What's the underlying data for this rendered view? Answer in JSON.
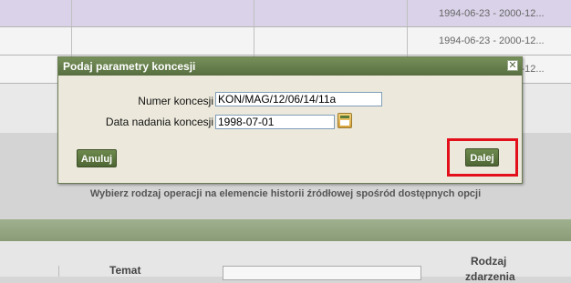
{
  "background_table": {
    "rows": [
      {
        "period": "1994-06-23 - 2000-12..."
      },
      {
        "period": "1994-06-23 - 2000-12..."
      },
      {
        "period": "1994-06-23 - 2000-12..."
      }
    ]
  },
  "instruction": "Wybierz rodzaj operacji na elemencie historii źródłowej spośród dostępnych opcji",
  "bottom_table": {
    "col_temat": "Temat",
    "col_rodzaj": "Rodzaj",
    "col_rodzaj_cont": "zdarzenia"
  },
  "dialog": {
    "title": "Podaj parametry koncesji",
    "close_glyph": "✕",
    "fields": {
      "numer_label": "Numer koncesji",
      "numer_value": "KON/MAG/12/06/14/11a",
      "data_label": "Data nadania koncesji",
      "data_value": "1998-07-01"
    },
    "buttons": {
      "cancel": "Anuluj",
      "next": "Dalej"
    }
  },
  "colors": {
    "title_bar": "#586e40",
    "highlight": "#e3101c",
    "selected_row": "#d9d2e8"
  }
}
